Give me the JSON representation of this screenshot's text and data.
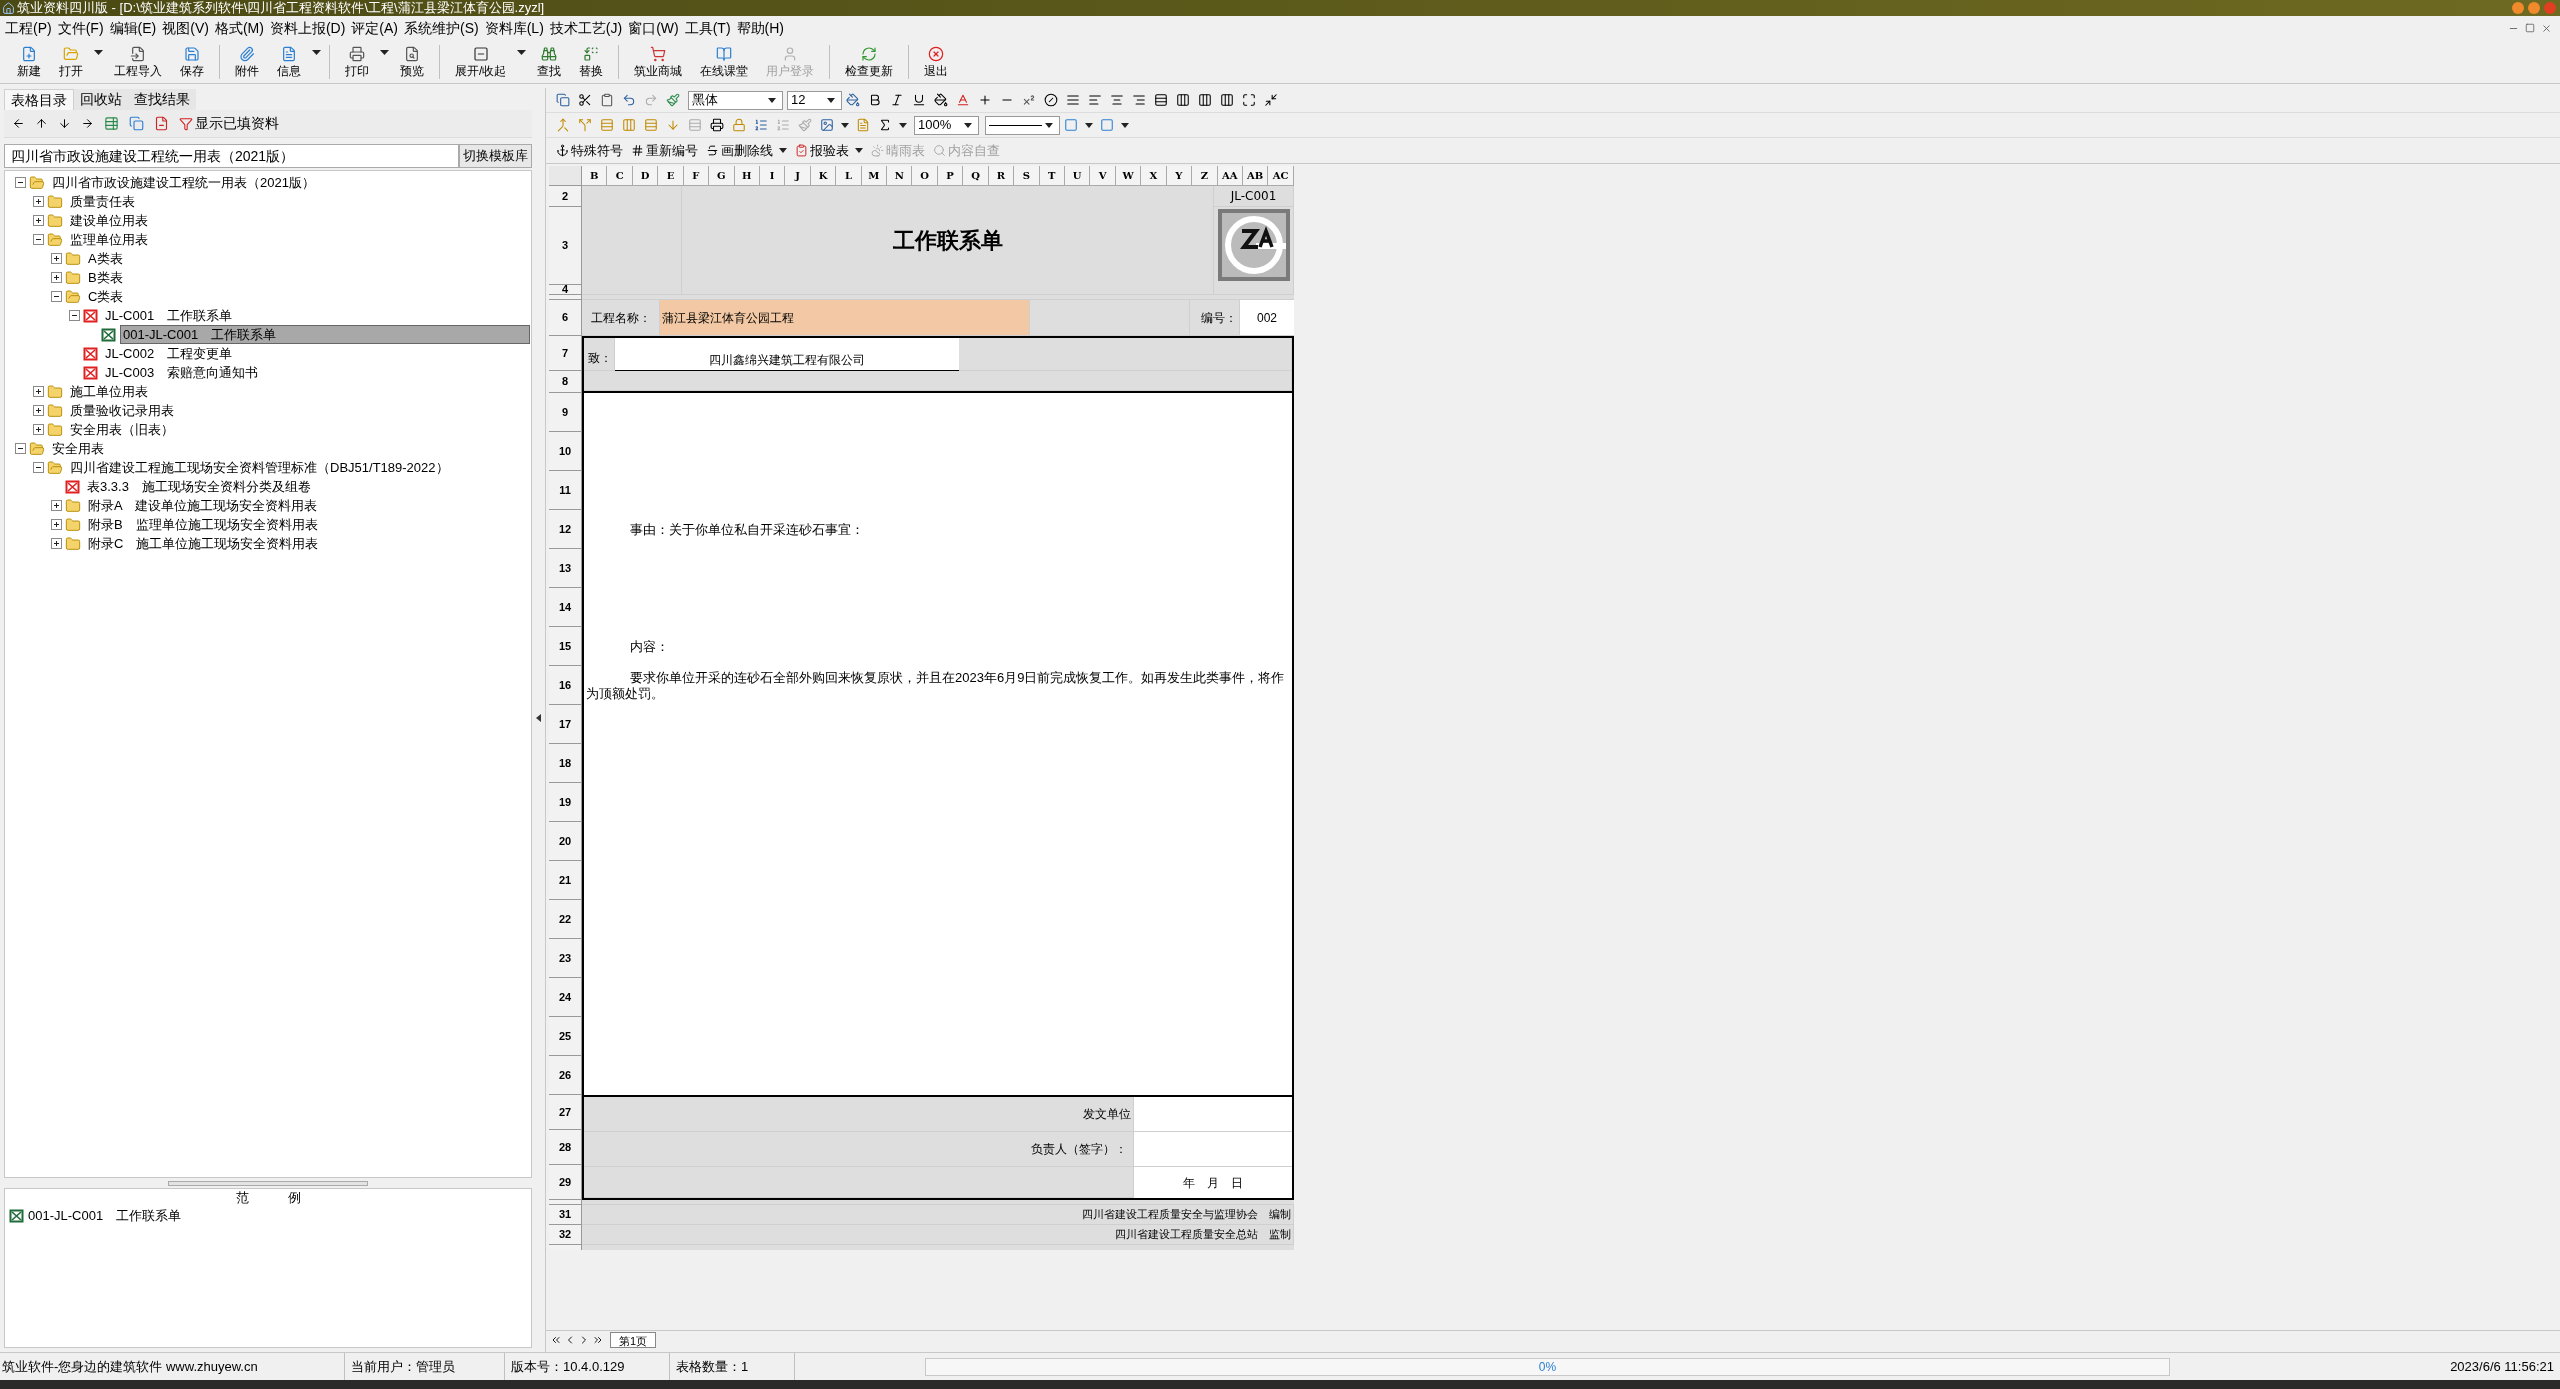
{
  "window": {
    "title": "筑业资料四川版 - [D:\\筑业建筑系列软件\\四川省工程资料软件\\工程\\蒲江县梁江体育公园.zyzl]"
  },
  "menu": [
    "工程(P)",
    "文件(F)",
    "编辑(E)",
    "视图(V)",
    "格式(M)",
    "资料上报(D)",
    "评定(A)",
    "系统维护(S)",
    "资料库(L)",
    "技术工艺(J)",
    "窗口(W)",
    "工具(T)",
    "帮助(H)"
  ],
  "toolbar": [
    [
      {
        "label": "新建",
        "disabled": false,
        "dropdown": false
      },
      {
        "label": "打开",
        "disabled": false,
        "dropdown": true
      },
      {
        "label": "工程导入",
        "disabled": false,
        "dropdown": false
      },
      {
        "label": "保存",
        "disabled": false,
        "dropdown": false
      }
    ],
    [
      {
        "label": "附件",
        "disabled": false,
        "dropdown": false
      },
      {
        "label": "信息",
        "disabled": false,
        "dropdown": true
      }
    ],
    [
      {
        "label": "打印",
        "disabled": false,
        "dropdown": true
      },
      {
        "label": "预览",
        "disabled": false,
        "dropdown": false
      }
    ],
    [
      {
        "label": "展开/收起",
        "disabled": false,
        "dropdown": true
      },
      {
        "label": "查找",
        "disabled": false,
        "dropdown": false
      },
      {
        "label": "替换",
        "disabled": false,
        "dropdown": false
      }
    ],
    [
      {
        "label": "筑业商城",
        "disabled": false,
        "dropdown": false
      },
      {
        "label": "在线课堂",
        "disabled": false,
        "dropdown": false
      },
      {
        "label": "用户登录",
        "disabled": true,
        "dropdown": false
      }
    ],
    [
      {
        "label": "检查更新",
        "disabled": false,
        "dropdown": false
      }
    ],
    [
      {
        "label": "退出",
        "disabled": false,
        "dropdown": false
      }
    ]
  ],
  "left_panel": {
    "tabs": [
      {
        "label": "表格目录",
        "selected": true
      },
      {
        "label": "回收站",
        "selected": false
      },
      {
        "label": "查找结果",
        "selected": false
      }
    ],
    "filter_label": "显示已填资料",
    "template": "四川省市政设施建设工程统一用表（2021版）",
    "switch_button": "切换模板库",
    "tree": [
      {
        "label": "四川省市政设施建设工程统一用表（2021版）",
        "kind": "folder",
        "expanded": true,
        "selected": false,
        "children": [
          {
            "label": "质量责任表",
            "kind": "folder",
            "expanded": false,
            "selected": false
          },
          {
            "label": "建设单位用表",
            "kind": "folder",
            "expanded": false,
            "selected": false
          },
          {
            "label": "监理单位用表",
            "kind": "folder",
            "expanded": true,
            "selected": false,
            "children": [
              {
                "label": "A类表",
                "kind": "folder",
                "expanded": false,
                "selected": false
              },
              {
                "label": "B类表",
                "kind": "folder",
                "expanded": false,
                "selected": false
              },
              {
                "label": "C类表",
                "kind": "folder",
                "expanded": true,
                "selected": false,
                "children": [
                  {
                    "label": "JL-C001　工作联系单",
                    "kind": "form",
                    "expanded": true,
                    "selected": false,
                    "children": [
                      {
                        "label": "001-JL-C001　工作联系单",
                        "kind": "record",
                        "selected": true
                      }
                    ]
                  },
                  {
                    "label": "JL-C002　工程变更单",
                    "kind": "form",
                    "selected": false
                  },
                  {
                    "label": "JL-C003　索赔意向通知书",
                    "kind": "form",
                    "selected": false
                  }
                ]
              }
            ]
          },
          {
            "label": "施工单位用表",
            "kind": "folder",
            "expanded": false,
            "selected": false
          },
          {
            "label": "质量验收记录用表",
            "kind": "folder",
            "expanded": false,
            "selected": false
          },
          {
            "label": "安全用表（旧表）",
            "kind": "folder",
            "expanded": false,
            "selected": false
          }
        ]
      },
      {
        "label": "安全用表",
        "kind": "folder",
        "expanded": true,
        "selected": false,
        "children": [
          {
            "label": "四川省建设工程施工现场安全资料管理标准（DBJ51/T189-2022）",
            "kind": "folder",
            "expanded": true,
            "selected": false,
            "children": [
              {
                "label": "表3.3.3　施工现场安全资料分类及组卷",
                "kind": "form",
                "selected": false
              },
              {
                "label": "附录A　建设单位施工现场安全资料用表",
                "kind": "folder",
                "expanded": false,
                "selected": false
              },
              {
                "label": "附录B　监理单位施工现场安全资料用表",
                "kind": "folder",
                "expanded": false,
                "selected": false
              },
              {
                "label": "附录C　施工单位施工现场安全资料用表",
                "kind": "folder",
                "expanded": false,
                "selected": false
              }
            ]
          }
        ]
      }
    ],
    "example": {
      "title": "范　　　例",
      "items": [
        {
          "label": "001-JL-C001　工作联系单"
        }
      ]
    }
  },
  "format_bar": {
    "font": "黑体",
    "size": "12",
    "zoom": "100%",
    "tools": [
      {
        "label": "特殊符号",
        "disabled": false,
        "dropdown": false
      },
      {
        "label": "重新编号",
        "disabled": false,
        "dropdown": false
      },
      {
        "label": "画删除线",
        "disabled": false,
        "dropdown": true
      },
      {
        "label": "报验表",
        "disabled": false,
        "dropdown": true
      },
      {
        "label": "晴雨表",
        "disabled": true,
        "dropdown": false
      },
      {
        "label": "内容自查",
        "disabled": true,
        "dropdown": false
      }
    ]
  },
  "sheet": {
    "columns": [
      "B",
      "C",
      "D",
      "E",
      "F",
      "G",
      "H",
      "I",
      "J",
      "K",
      "L",
      "M",
      "N",
      "O",
      "P",
      "Q",
      "R",
      "S",
      "T",
      "U",
      "V",
      "W",
      "X",
      "Y",
      "Z",
      "AA",
      "AB",
      "AC"
    ],
    "rows": [
      "2",
      "3",
      "4",
      "6",
      "7",
      "8",
      "9",
      "10",
      "11",
      "12",
      "13",
      "14",
      "15",
      "16",
      "17",
      "18",
      "19",
      "20",
      "21",
      "22",
      "23",
      "24",
      "25",
      "26",
      "27",
      "28",
      "29",
      "31",
      "32"
    ],
    "code": "JL-C001",
    "title": "工作联系单",
    "project_label": "工程名称：",
    "project_name": "蒲江县梁江体育公园工程",
    "number_label": "编号：",
    "number_value": "002",
    "to_label": "致：",
    "to_value": "四川鑫绵兴建筑工程有限公司",
    "subject": "事由：关于你单位私自开采连砂石事宜：",
    "content_label": "内容：",
    "content_text": "要求你单位开采的连砂石全部外购回来恢复原状，并且在2023年6月9日前完成恢复工作。如再发生此类事件，将作为顶额处罚。",
    "issuer_label": "发文单位",
    "signer_label": "负责人（签字）：",
    "date_label": "年　月　日",
    "footer": [
      "四川省建设工程质量安全与监理协会　编制",
      "四川省建设工程质量安全总站　监制"
    ],
    "page_tab": "第1页"
  },
  "status_bar": {
    "slogan": "筑业软件-您身边的建筑软件 www.zhuyew.cn",
    "user": "当前用户：管理员",
    "version": "版本号：10.4.0.129",
    "count": "表格数量：1",
    "progress": {
      "level": 0,
      "reading": "0%"
    },
    "datetime": "2023/6/6 11:56:21"
  }
}
